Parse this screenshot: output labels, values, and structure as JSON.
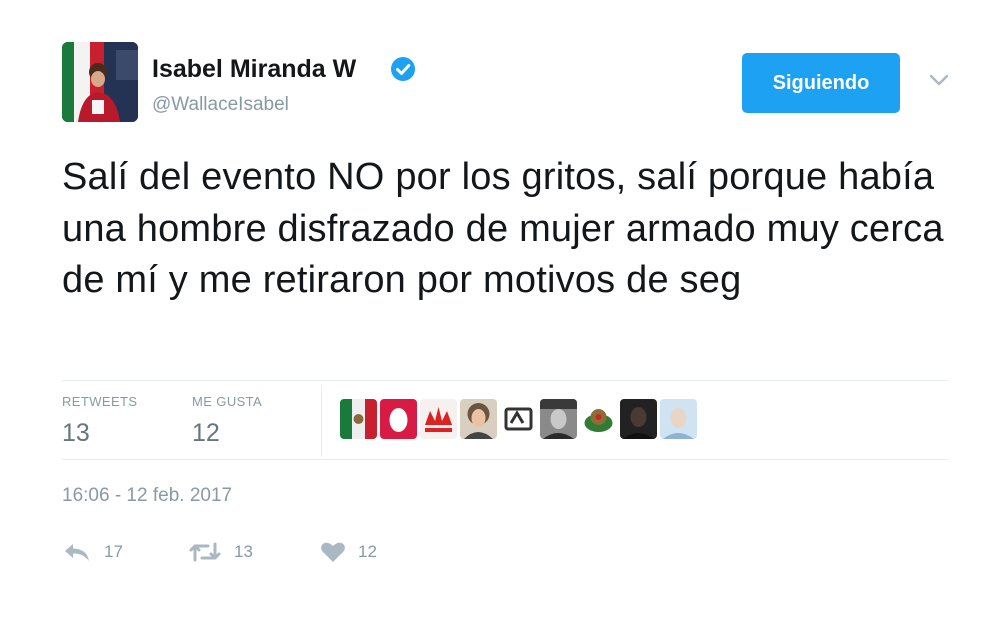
{
  "user": {
    "name": "Isabel Miranda W",
    "handle": "@WallaceIsabel"
  },
  "follow_button": {
    "label": "Siguiendo"
  },
  "tweet": {
    "text": "Salí del evento NO por los gritos, salí porque había una hombre disfrazado de mujer armado muy cerca de mí y me retiraron por motivos de seg"
  },
  "stats": {
    "retweets_label": "RETWEETS",
    "retweets_value": "13",
    "likes_label": "ME GUSTA",
    "likes_value": "12"
  },
  "likers": [
    "flag-avatar",
    "pink-avatar",
    "red-logo-avatar",
    "woman-avatar",
    "logo-avatar",
    "bw-portrait-avatar",
    "eagle-avatar",
    "dark-avatar",
    "light-avatar"
  ],
  "timestamp": "16:06 - 12 feb. 2017",
  "actions": {
    "reply_count": "17",
    "retweet_count": "13",
    "like_count": "12"
  },
  "colors": {
    "accent": "#1da1f2",
    "secondary_text": "#8899a6",
    "divider": "#e6ecf0"
  }
}
